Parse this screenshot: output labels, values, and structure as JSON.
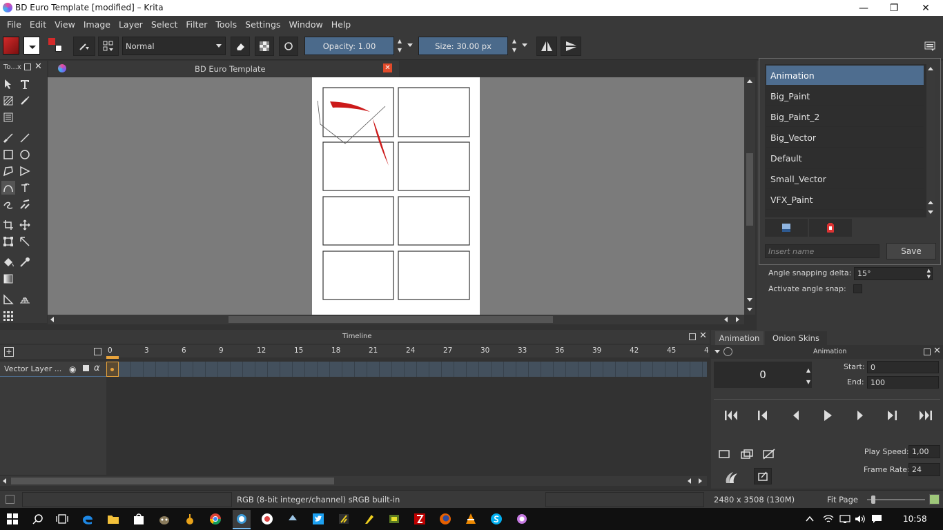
{
  "window": {
    "title": "BD Euro Template [modified] – Krita"
  },
  "menu": [
    "File",
    "Edit",
    "View",
    "Image",
    "Layer",
    "Select",
    "Filter",
    "Tools",
    "Settings",
    "Window",
    "Help"
  ],
  "toolbar": {
    "blend_mode": "Normal",
    "opacity_label": "Opacity:  1.00",
    "size_label": "Size:  30.00 px"
  },
  "toolbox": {
    "title": "To...x"
  },
  "document": {
    "tab_title": "BD Euro Template"
  },
  "presets": {
    "items": [
      "Animation",
      "Big_Paint",
      "Big_Paint_2",
      "Big_Vector",
      "Default",
      "Small_Vector",
      "VFX_Paint"
    ],
    "selected": "Animation",
    "name_placeholder": "Insert name",
    "save_label": "Save"
  },
  "tool_options": {
    "angle_snapping_label": "Angle snapping delta:",
    "angle_snapping_value": "15°",
    "activate_angle_snap_label": "Activate angle snap:"
  },
  "timeline": {
    "title": "Timeline",
    "ruler": [
      "0",
      "3",
      "6",
      "9",
      "12",
      "15",
      "18",
      "21",
      "24",
      "27",
      "30",
      "33",
      "36",
      "39",
      "42",
      "45",
      "4"
    ],
    "layer_name": "Vector Layer ..."
  },
  "animation_panel": {
    "tabs": [
      "Animation",
      "Onion Skins"
    ],
    "title": "Animation",
    "current_frame": "0",
    "start_label": "Start:",
    "start_value": "0",
    "end_label": "End:",
    "end_value": "100",
    "play_speed_label": "Play Speed:",
    "play_speed_value": "1,00",
    "frame_rate_label": "Frame Rate:",
    "frame_rate_value": "24"
  },
  "status": {
    "color_space": "RGB (8-bit integer/channel)  sRGB built-in",
    "image_size": "2480 x 3508 (130M)",
    "zoom": "Fit Page"
  },
  "taskbar": {
    "clock": "10:58"
  },
  "colors": {
    "accent": "#4b6a8b",
    "selection": "#4e6d8f",
    "close_red": "#e14a2a",
    "stroke_red": "#cc1a1a"
  }
}
